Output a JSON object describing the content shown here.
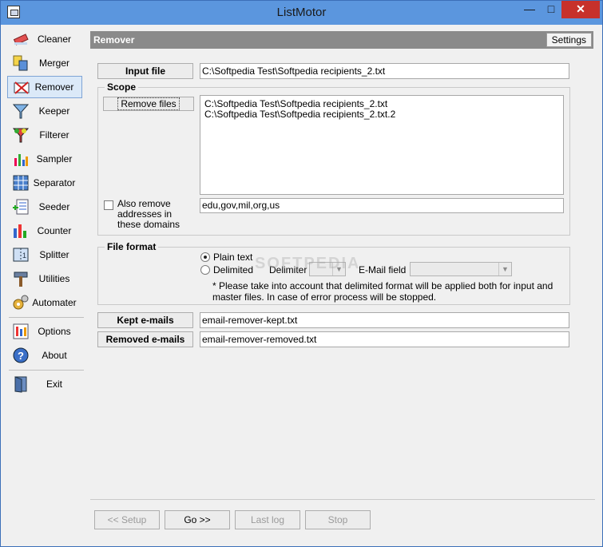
{
  "window": {
    "title": "ListMotor"
  },
  "sidebar": {
    "items": [
      {
        "label": "Cleaner",
        "icon": "eraser-icon"
      },
      {
        "label": "Merger",
        "icon": "merge-icon"
      },
      {
        "label": "Remover",
        "icon": "remove-icon"
      },
      {
        "label": "Keeper",
        "icon": "funnel-icon"
      },
      {
        "label": "Filterer",
        "icon": "filter-icon"
      },
      {
        "label": "Sampler",
        "icon": "chart-icon"
      },
      {
        "label": "Separator",
        "icon": "grid-icon"
      },
      {
        "label": "Seeder",
        "icon": "list-add-icon"
      },
      {
        "label": "Counter",
        "icon": "bar-chart-icon"
      },
      {
        "label": "Splitter",
        "icon": "split-icon"
      },
      {
        "label": "Utilities",
        "icon": "hammer-icon"
      },
      {
        "label": "Automater",
        "icon": "gears-icon"
      },
      {
        "label": "Options",
        "icon": "options-icon"
      },
      {
        "label": "About",
        "icon": "help-icon"
      },
      {
        "label": "Exit",
        "icon": "exit-door-icon"
      }
    ],
    "active": "Remover"
  },
  "panel": {
    "title": "Remover",
    "settings_label": "Settings",
    "input_file_label": "Input file",
    "input_file_value": "C:\\Softpedia Test\\Softpedia recipients_2.txt",
    "scope_label": "Scope",
    "remove_files_label": "Remove files",
    "remove_files_list": [
      "C:\\Softpedia Test\\Softpedia recipients_2.txt",
      "C:\\Softpedia Test\\Softpedia recipients_2.txt.2"
    ],
    "also_remove_label": "Also remove addresses in these domains",
    "domains_value": "edu,gov,mil,org,us",
    "file_format_label": "File format",
    "plain_text_label": "Plain text",
    "delimited_label": "Delimited",
    "delimiter_label": "Delimiter",
    "email_field_label": "E-Mail field",
    "note": "* Please take into account that delimited format will be applied both for input and master files. In case of error process will be stopped.",
    "kept_label": "Kept e-mails",
    "kept_value": "email-remover-kept.txt",
    "removed_label": "Removed e-mails",
    "removed_value": "email-remover-removed.txt",
    "watermark": "SOFTPEDIA"
  },
  "footer": {
    "setup_label": "<< Setup",
    "go_label": "Go >>",
    "last_log_label": "Last log",
    "stop_label": "Stop"
  }
}
